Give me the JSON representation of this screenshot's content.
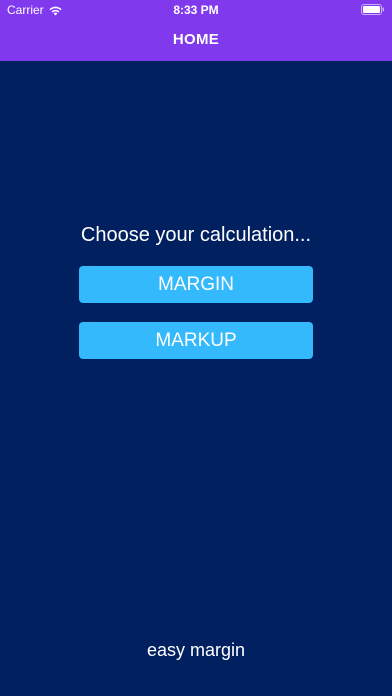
{
  "status_bar": {
    "carrier": "Carrier",
    "time": "8:33 PM",
    "wifi_icon": "wifi-icon",
    "battery_icon": "battery-icon"
  },
  "nav": {
    "title": "HOME"
  },
  "main": {
    "prompt": "Choose your calculation...",
    "buttons": [
      {
        "label": "MARGIN"
      },
      {
        "label": "MARKUP"
      }
    ],
    "footer": "easy margin"
  },
  "colors": {
    "nav_background": "#8139ee",
    "page_background": "#012060",
    "button_background": "#33b9fc",
    "text": "#ffffff"
  }
}
